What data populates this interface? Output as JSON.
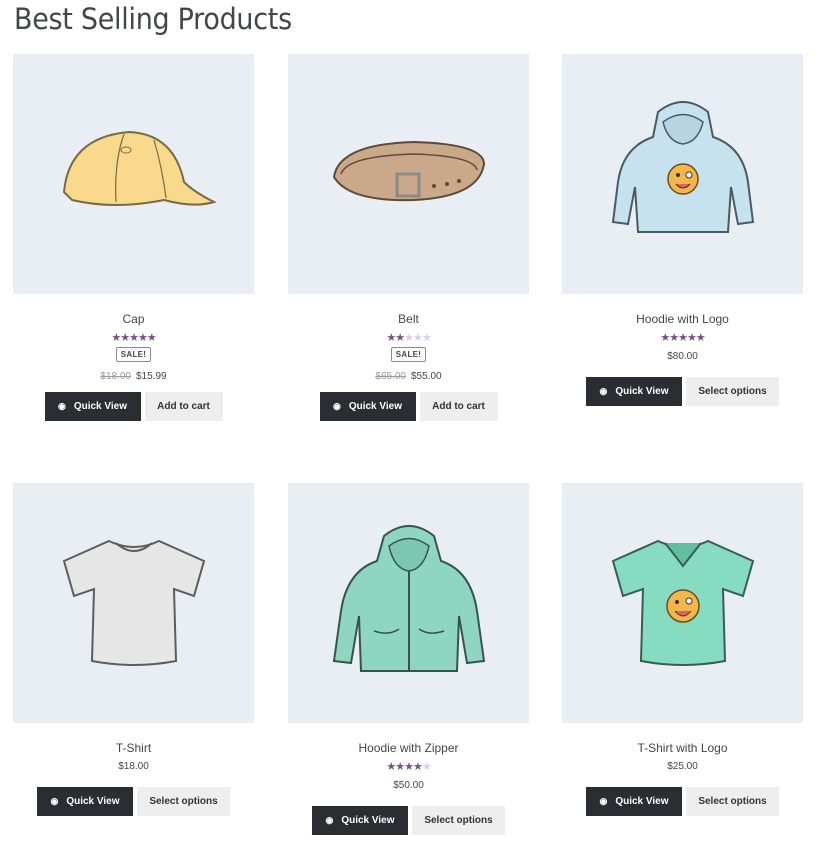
{
  "page": {
    "title": "Best Selling Products"
  },
  "products": [
    {
      "name": "Cap",
      "rating": 5,
      "sale": "SALE!",
      "old_price": "$18.00",
      "price": "$15.99",
      "quick_view": "Quick View",
      "action": "Add to cart",
      "image_icon": "cap-icon",
      "colors": {
        "fill": "#f9d98b",
        "stroke": "#7a6a45"
      }
    },
    {
      "name": "Belt",
      "rating": 2,
      "sale": "SALE!",
      "old_price": "$65.00",
      "price": "$55.00",
      "quick_view": "Quick View",
      "action": "Add to cart",
      "image_icon": "belt-icon",
      "colors": {
        "fill": "#c9a98a",
        "stroke": "#5e4a38"
      }
    },
    {
      "name": "Hoodie with Logo",
      "rating": 5,
      "sale": "",
      "old_price": "",
      "price": "$80.00",
      "quick_view": "Quick View",
      "action": "Select options",
      "image_icon": "hoodie-icon",
      "colors": {
        "fill": "#c7e2ef",
        "stroke": "#4b5a63"
      }
    },
    {
      "name": "T-Shirt",
      "rating": 0,
      "sale": "",
      "old_price": "",
      "price": "$18.00",
      "quick_view": "Quick View",
      "action": "Select options",
      "image_icon": "tshirt-icon",
      "colors": {
        "fill": "#e6e6e6",
        "stroke": "#5d5d5d"
      }
    },
    {
      "name": "Hoodie with Zipper",
      "rating": 4,
      "sale": "",
      "old_price": "",
      "price": "$50.00",
      "quick_view": "Quick View",
      "action": "Select options",
      "image_icon": "zip-hoodie-icon",
      "colors": {
        "fill": "#8ed6c0",
        "stroke": "#36544c"
      }
    },
    {
      "name": "T-Shirt with Logo",
      "rating": 0,
      "sale": "",
      "old_price": "",
      "price": "$25.00",
      "quick_view": "Quick View",
      "action": "Select options",
      "image_icon": "logo-tshirt-icon",
      "colors": {
        "fill": "#86dcc0",
        "stroke": "#3b5c52"
      }
    }
  ],
  "star_colors": {
    "on": "#7a4f87",
    "off": "#d9cfe0"
  },
  "button_colors": {
    "quick_view_bg": "#2c2d33",
    "secondary_bg": "#eeeeee"
  },
  "image_bg": "#e8eef3"
}
